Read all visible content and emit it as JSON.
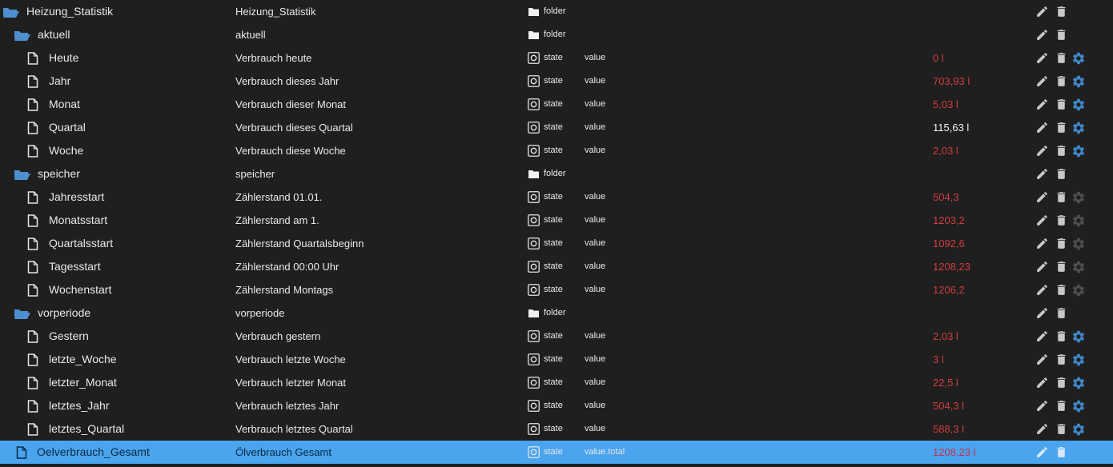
{
  "colors": {
    "background": "#1f1f1f",
    "selected_row": "#4aa4ee",
    "folder_icon": "#4e8fd0",
    "value_red": "#cf3d3d",
    "value_white": "#f2f2f2",
    "gear_blue": "#3f86c7",
    "gear_grey": "#4d4d4d",
    "action_grey": "#c8c8c8"
  },
  "rows": [
    {
      "kind": "folder",
      "level": 0,
      "name": "Heizung_Statistik",
      "desc": "Heizung_Statistik",
      "type": "folder",
      "role": "",
      "value": "",
      "ack": false,
      "gear": "none",
      "selected": false
    },
    {
      "kind": "folder",
      "level": 1,
      "name": "aktuell",
      "desc": "aktuell",
      "type": "folder",
      "role": "",
      "value": "",
      "ack": false,
      "gear": "none",
      "selected": false
    },
    {
      "kind": "state",
      "level": 2,
      "name": "Heute",
      "desc": "Verbrauch heute",
      "type": "state",
      "role": "value",
      "value": "0 l",
      "ack": false,
      "gear": "blue",
      "selected": false
    },
    {
      "kind": "state",
      "level": 2,
      "name": "Jahr",
      "desc": "Verbrauch dieses Jahr",
      "type": "state",
      "role": "value",
      "value": "703,93 l",
      "ack": false,
      "gear": "blue",
      "selected": false
    },
    {
      "kind": "state",
      "level": 2,
      "name": "Monat",
      "desc": "Verbrauch dieser Monat",
      "type": "state",
      "role": "value",
      "value": "5,03 l",
      "ack": false,
      "gear": "blue",
      "selected": false
    },
    {
      "kind": "state",
      "level": 2,
      "name": "Quartal",
      "desc": "Verbrauch dieses Quartal",
      "type": "state",
      "role": "value",
      "value": "115,63 l",
      "ack": true,
      "gear": "blue",
      "selected": false
    },
    {
      "kind": "state",
      "level": 2,
      "name": "Woche",
      "desc": "Verbrauch diese Woche",
      "type": "state",
      "role": "value",
      "value": "2,03 l",
      "ack": false,
      "gear": "blue",
      "selected": false
    },
    {
      "kind": "folder",
      "level": 1,
      "name": "speicher",
      "desc": "speicher",
      "type": "folder",
      "role": "",
      "value": "",
      "ack": false,
      "gear": "none",
      "selected": false
    },
    {
      "kind": "state",
      "level": 2,
      "name": "Jahresstart",
      "desc": "Zählerstand 01.01.",
      "type": "state",
      "role": "value",
      "value": "504,3",
      "ack": false,
      "gear": "grey",
      "selected": false
    },
    {
      "kind": "state",
      "level": 2,
      "name": "Monatsstart",
      "desc": "Zählerstand am 1.",
      "type": "state",
      "role": "value",
      "value": "1203,2",
      "ack": false,
      "gear": "grey",
      "selected": false
    },
    {
      "kind": "state",
      "level": 2,
      "name": "Quartalsstart",
      "desc": "Zählerstand Quartalsbeginn",
      "type": "state",
      "role": "value",
      "value": "1092,6",
      "ack": false,
      "gear": "grey",
      "selected": false
    },
    {
      "kind": "state",
      "level": 2,
      "name": "Tagesstart",
      "desc": "Zählerstand 00:00 Uhr",
      "type": "state",
      "role": "value",
      "value": "1208,23",
      "ack": false,
      "gear": "grey",
      "selected": false
    },
    {
      "kind": "state",
      "level": 2,
      "name": "Wochenstart",
      "desc": "Zählerstand Montags",
      "type": "state",
      "role": "value",
      "value": "1206,2",
      "ack": false,
      "gear": "grey",
      "selected": false
    },
    {
      "kind": "folder",
      "level": 1,
      "name": "vorperiode",
      "desc": "vorperiode",
      "type": "folder",
      "role": "",
      "value": "",
      "ack": false,
      "gear": "none",
      "selected": false
    },
    {
      "kind": "state",
      "level": 2,
      "name": "Gestern",
      "desc": "Verbrauch gestern",
      "type": "state",
      "role": "value",
      "value": "2,03 l",
      "ack": false,
      "gear": "blue",
      "selected": false
    },
    {
      "kind": "state",
      "level": 2,
      "name": "letzte_Woche",
      "desc": "Verbrauch letzte Woche",
      "type": "state",
      "role": "value",
      "value": "3 l",
      "ack": false,
      "gear": "blue",
      "selected": false
    },
    {
      "kind": "state",
      "level": 2,
      "name": "letzter_Monat",
      "desc": "Verbrauch letzter Monat",
      "type": "state",
      "role": "value",
      "value": "22,5 l",
      "ack": false,
      "gear": "blue",
      "selected": false
    },
    {
      "kind": "state",
      "level": 2,
      "name": "letztes_Jahr",
      "desc": "Verbrauch letztes Jahr",
      "type": "state",
      "role": "value",
      "value": "504,3 l",
      "ack": false,
      "gear": "blue",
      "selected": false
    },
    {
      "kind": "state",
      "level": 2,
      "name": "letztes_Quartal",
      "desc": "Verbrauch letztes Quartal",
      "type": "state",
      "role": "value",
      "value": "588,3 l",
      "ack": false,
      "gear": "blue",
      "selected": false
    },
    {
      "kind": "state",
      "level": 1,
      "name": "Oelverbrauch_Gesamt",
      "desc": "Ölverbrauch Gesamt",
      "type": "state",
      "role": "value.total",
      "value": "1208,23 l",
      "ack": false,
      "gear": "none",
      "selected": true
    }
  ]
}
